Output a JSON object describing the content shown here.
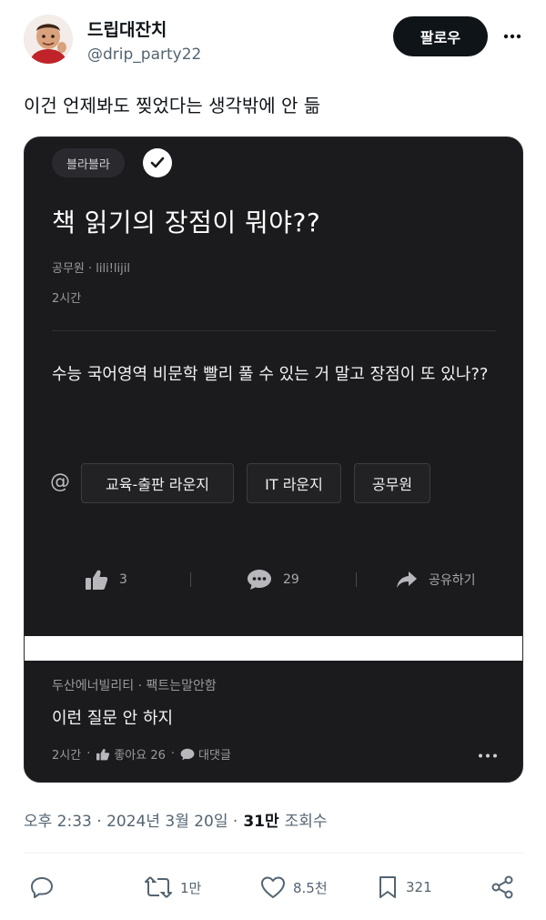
{
  "author": {
    "display_name": "드립대잔치",
    "handle": "@drip_party22"
  },
  "follow_label": "팔로우",
  "tweet_text": "이건 언제봐도 찢었다는 생각밖에 안 듦",
  "embedded_post": {
    "community_chip": "블라블라",
    "title": "책 읽기의 장점이 뭐야??",
    "meta": "공무원 · lili!lijil",
    "time": "2시간",
    "body": "수능 국어영역 비문학 빨리 풀 수 있는 거 말고 장점이 또 있나??",
    "at_symbol": "@",
    "tags": [
      "교육-출판 라운지",
      "IT 라운지",
      "공무원"
    ],
    "like_count": "3",
    "comment_count": "29",
    "share_label": "공유하기",
    "comment": {
      "author": "두산에너빌리티 · 팩트는말안함",
      "text": "이런 질문 안 하지",
      "time": "2시간",
      "dot": "·",
      "likes": "좋아요 26",
      "reply_label": "대댓글"
    }
  },
  "timestamp": {
    "text": "오후 2:33 · 2024년 3월 20일 ·",
    "views": "31만",
    "views_label": "조회수"
  },
  "actions": {
    "retweets": "1만",
    "likes": "8.5천",
    "bookmarks": "321"
  }
}
